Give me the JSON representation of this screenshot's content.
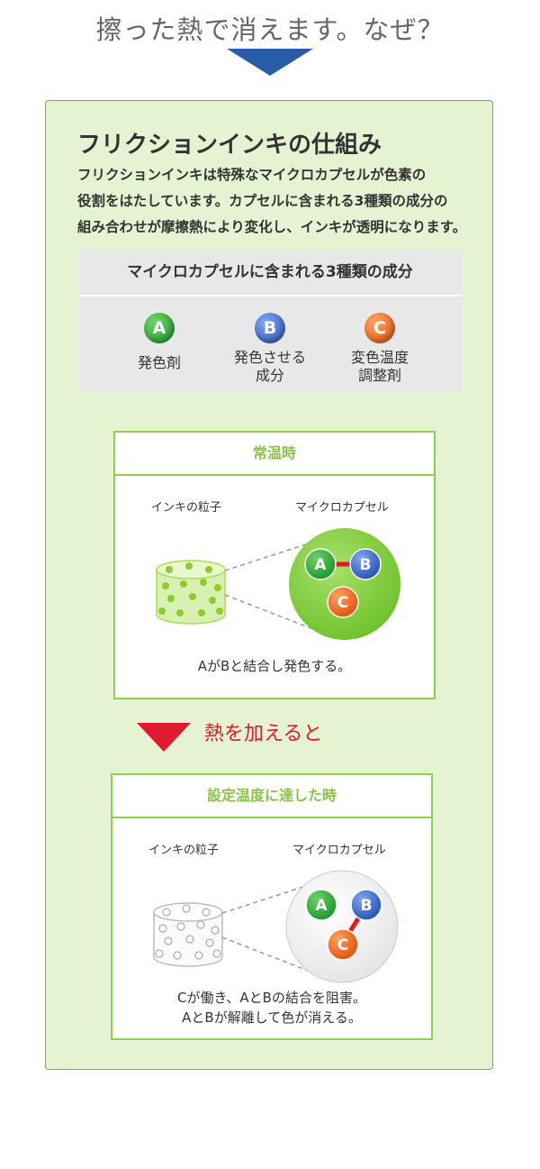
{
  "page": {
    "title": "擦った熱で消えます。なぜ？"
  },
  "panel": {
    "heading": "フリクションインキの仕組み",
    "intro_lines": [
      "フリクションインキは特殊なマイクロカプセルが色素の",
      "役割をはたしています。カプセルに含まれる3種類の成分の",
      "組み合わせが摩擦熱により変化し、インキが透明になります。"
    ]
  },
  "components": {
    "title": "マイクロカプセルに含まれる3種類の成分",
    "items": [
      {
        "letter": "A",
        "label_1": "発色剤",
        "label_2": ""
      },
      {
        "letter": "B",
        "label_1": "発色させる",
        "label_2": "成分"
      },
      {
        "letter": "C",
        "label_1": "変色温度",
        "label_2": "調整剤"
      }
    ]
  },
  "state_normal": {
    "title": "常温時",
    "label_particle": "インキの粒子",
    "label_capsule": "マイクロカプセル",
    "caption_1": "AがBと結合し発色する。",
    "ball_a": "A",
    "ball_b": "B",
    "ball_c": "C"
  },
  "heat": {
    "label": "熱を加えると",
    "color": "#e0192f"
  },
  "state_heated": {
    "title": "設定温度に達した時",
    "label_particle": "インキの粒子",
    "label_capsule": "マイクロカプセル",
    "caption_1": "Cが働き、AとBの結合を阻害。",
    "caption_2": "AとBが解離して色が消える。",
    "ball_a": "A",
    "ball_b": "B",
    "ball_c": "C"
  },
  "colors": {
    "accent_green": "#8bd24a",
    "arrow_blue": "#2a5da8",
    "panel_bg": "#e6f3d2"
  }
}
